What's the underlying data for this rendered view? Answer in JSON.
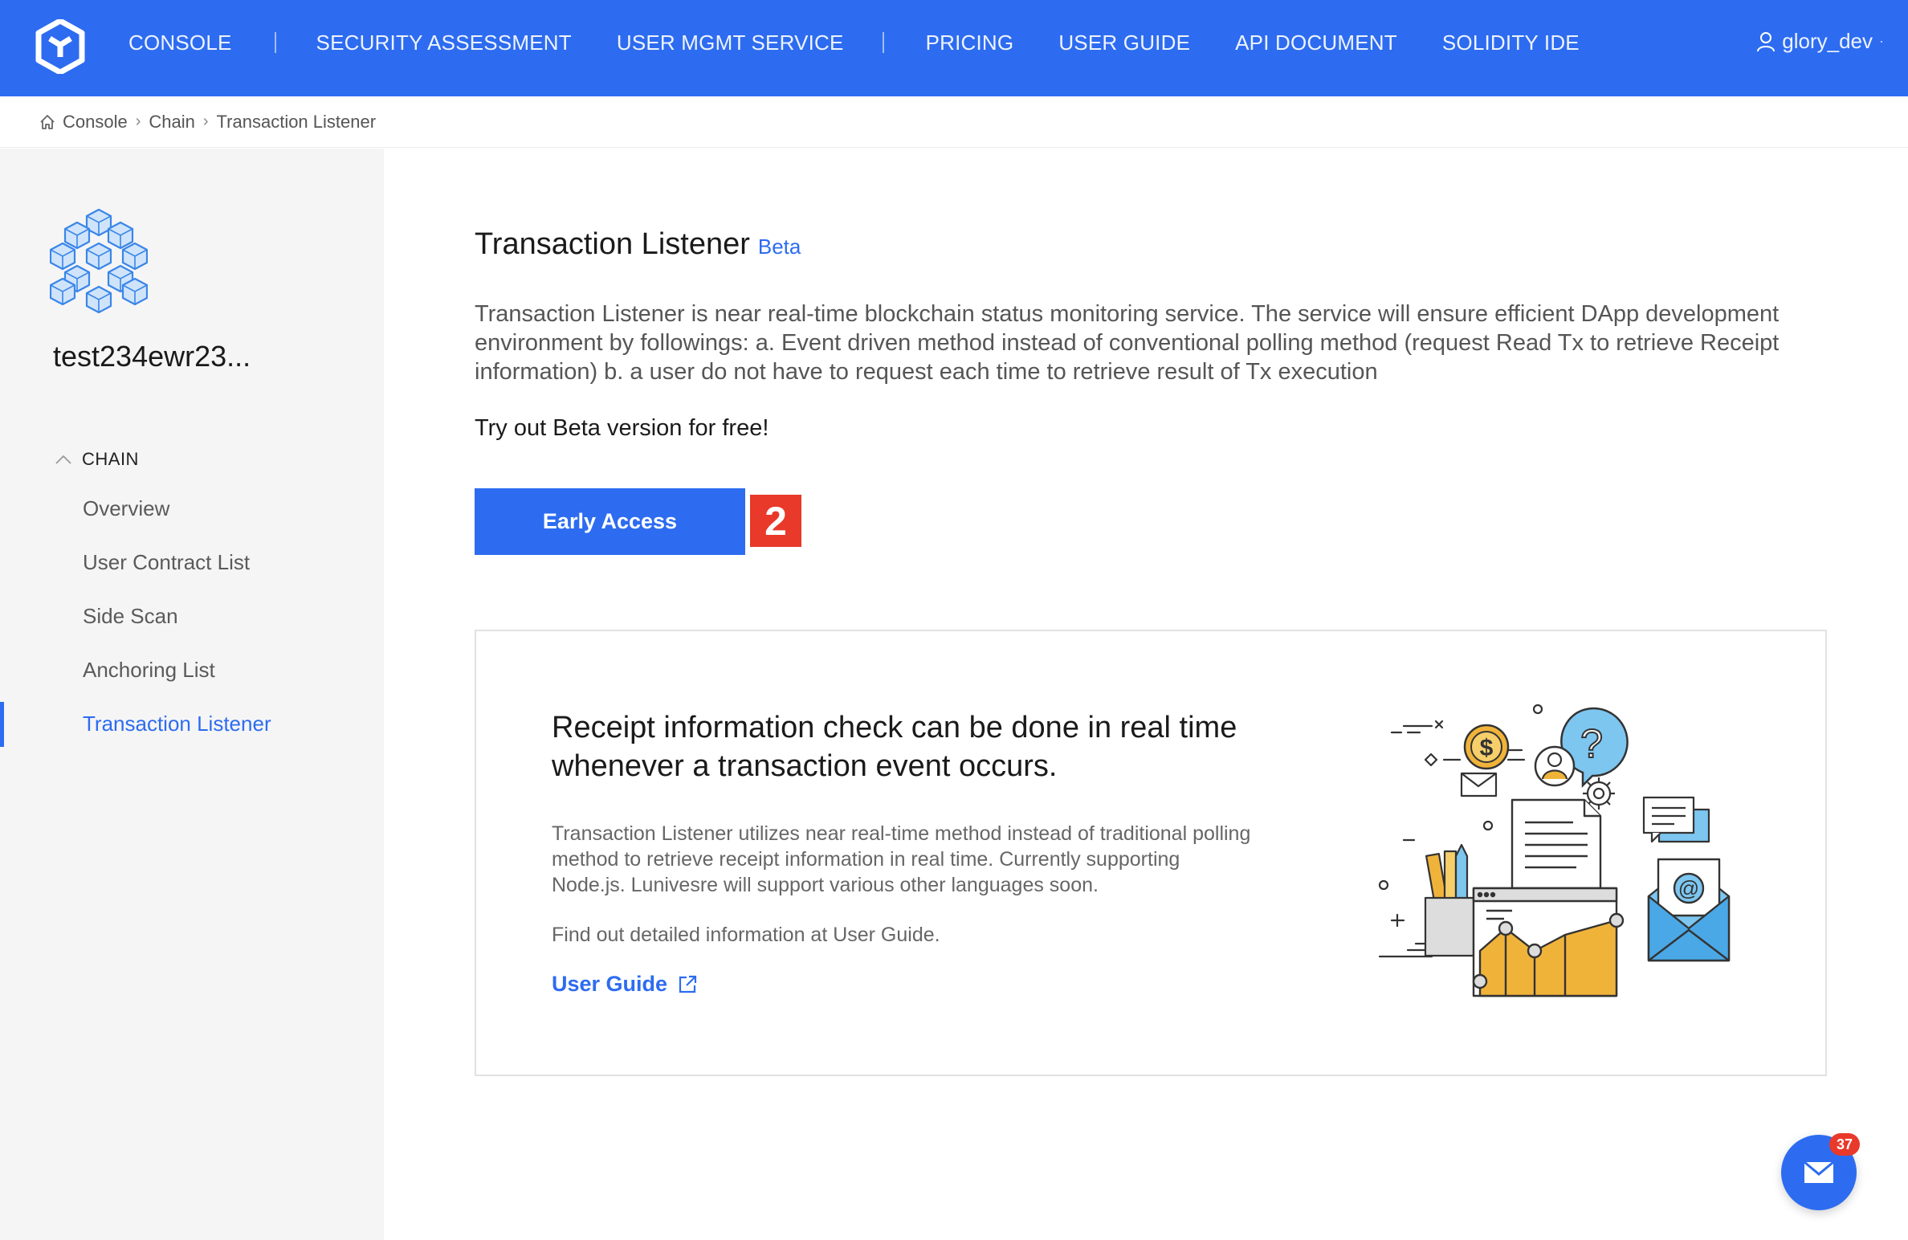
{
  "topnav": {
    "items": [
      {
        "label": "CONSOLE"
      },
      {
        "label": "SECURITY ASSESSMENT"
      },
      {
        "label": "USER MGMT SERVICE"
      },
      {
        "label": "PRICING"
      },
      {
        "label": "USER GUIDE"
      },
      {
        "label": "API DOCUMENT"
      },
      {
        "label": "SOLIDITY IDE"
      }
    ],
    "user": "glory_dev"
  },
  "breadcrumb": [
    "Console",
    "Chain",
    "Transaction Listener"
  ],
  "sidebar": {
    "project_name": "test234ewr23...",
    "section": "CHAIN",
    "items": [
      {
        "label": "Overview"
      },
      {
        "label": "User Contract List"
      },
      {
        "label": "Side Scan"
      },
      {
        "label": "Anchoring List"
      },
      {
        "label": "Transaction Listener"
      }
    ]
  },
  "main": {
    "title": "Transaction Listener",
    "beta": "Beta",
    "description": "Transaction Listener is near real-time blockchain status monitoring service. The service will ensure efficient DApp development environment by followings: a. Event driven method instead of conventional polling method (request Read Tx to retrieve Receipt information) b. a user do not have to request each time to retrieve result of Tx execution",
    "tryout": "Try out Beta version for free!",
    "early_access": "Early Access",
    "step_badge": "2"
  },
  "card": {
    "heading": "Receipt information check can be done in real time whenever a transaction event occurs.",
    "body": "Transaction Listener utilizes near real-time method instead of traditional polling method to retrieve receipt information in real time. Currently supporting Node.js. Lunivesre will support various other languages soon.",
    "find": "Find out detailed information at User Guide.",
    "link": "User Guide"
  },
  "chat": {
    "count": "37"
  },
  "colors": {
    "primary": "#2d6cf0",
    "badge": "#e8392a",
    "illustration_orange": "#f0b33a",
    "illustration_blue": "#7cc6f0"
  }
}
